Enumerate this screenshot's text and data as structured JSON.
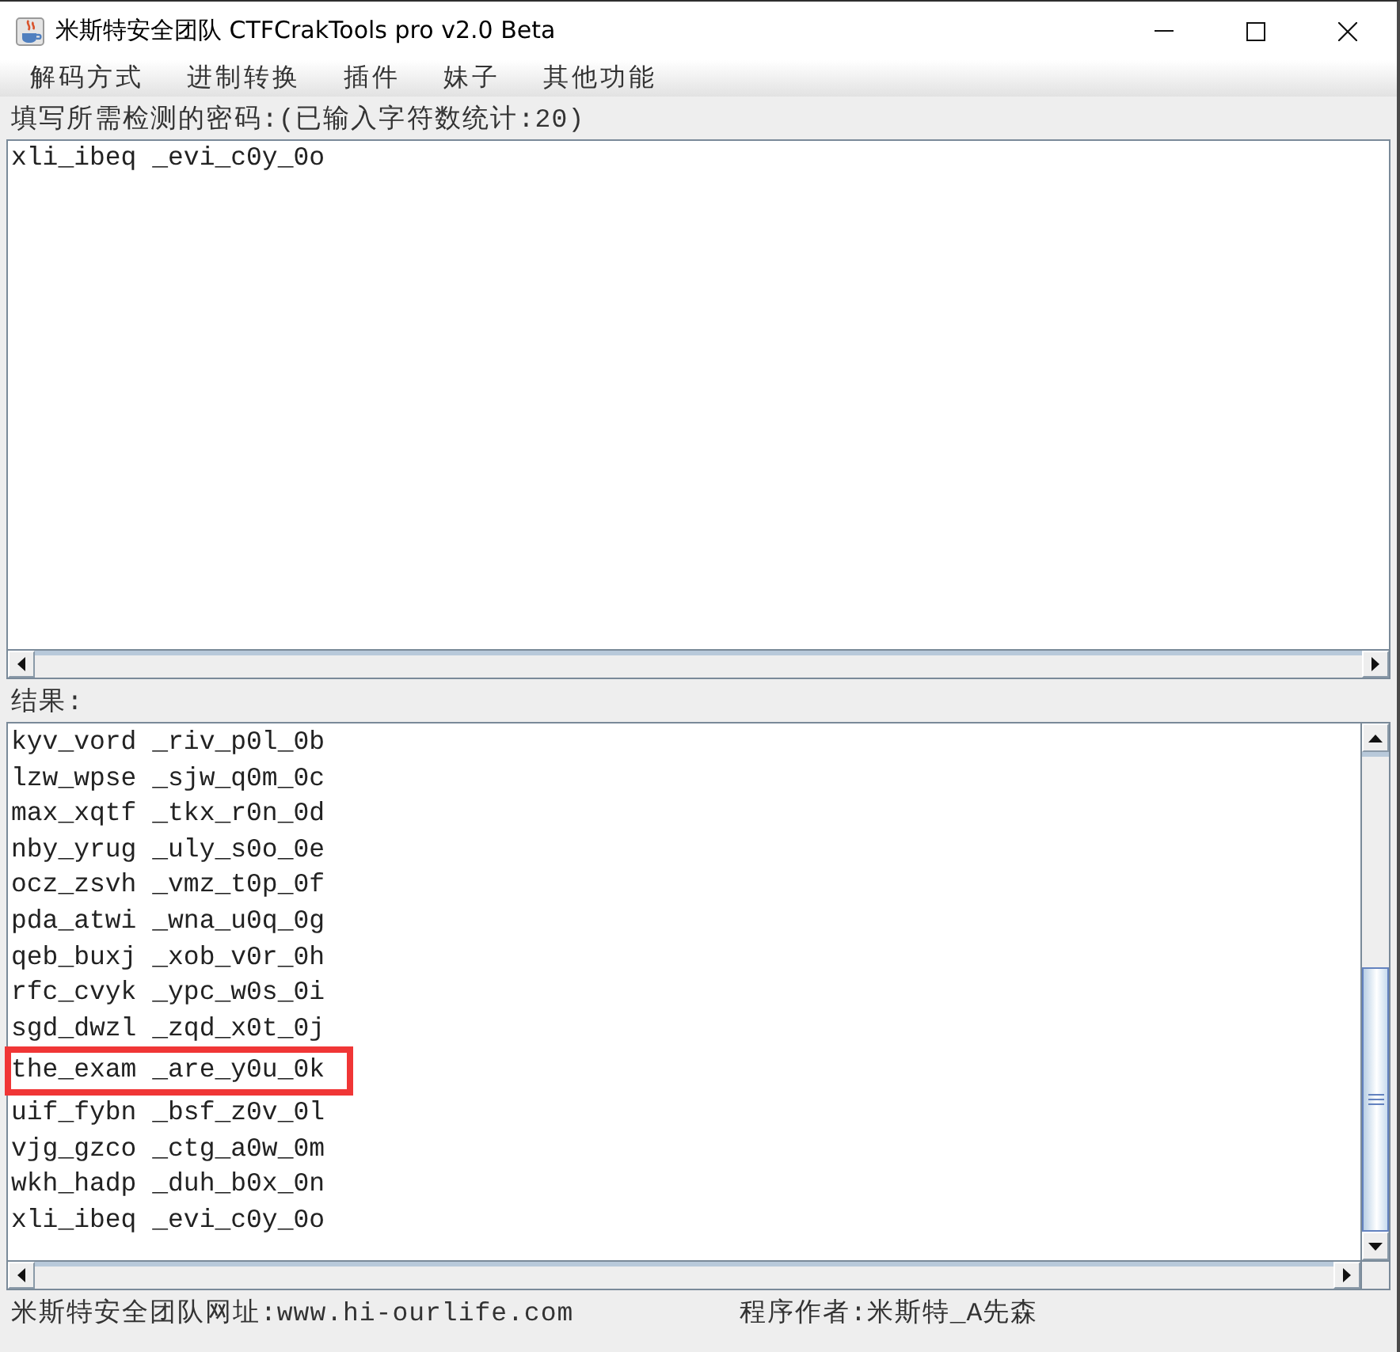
{
  "window": {
    "title": "米斯特安全团队 CTFCrakTools pro v2.0 Beta"
  },
  "menu": [
    "解码方式",
    "进制转换",
    "插件",
    "妹子",
    "其他功能"
  ],
  "input": {
    "label": "填写所需检测的密码:(已输入字符数统计:20)",
    "value": "xli_ibeq _evi_c0y_0o"
  },
  "results": {
    "label": "结果:",
    "lines": [
      {
        "text": "kyv_vord _riv_p0l_0b",
        "highlighted": false
      },
      {
        "text": "lzw_wpse _sjw_q0m_0c",
        "highlighted": false
      },
      {
        "text": "max_xqtf _tkx_r0n_0d",
        "highlighted": false
      },
      {
        "text": "nby_yrug _uly_s0o_0e",
        "highlighted": false
      },
      {
        "text": "ocz_zsvh _vmz_t0p_0f",
        "highlighted": false
      },
      {
        "text": "pda_atwi _wna_u0q_0g",
        "highlighted": false
      },
      {
        "text": "qeb_buxj _xob_v0r_0h",
        "highlighted": false
      },
      {
        "text": "rfc_cvyk _ypc_w0s_0i",
        "highlighted": false
      },
      {
        "text": "sgd_dwzl _zqd_x0t_0j",
        "highlighted": false
      },
      {
        "text": "the_exam _are_y0u_0k",
        "highlighted": true
      },
      {
        "text": "uif_fybn _bsf_z0v_0l",
        "highlighted": false
      },
      {
        "text": "vjg_gzco _ctg_a0w_0m",
        "highlighted": false
      },
      {
        "text": "wkh_hadp _duh_b0x_0n",
        "highlighted": false
      },
      {
        "text": "xli_ibeq _evi_c0y_0o",
        "highlighted": false
      }
    ]
  },
  "status_bar": {
    "website": "米斯特安全团队网址:www.hi-ourlife.com",
    "author": "程序作者:米斯特_A先森"
  }
}
